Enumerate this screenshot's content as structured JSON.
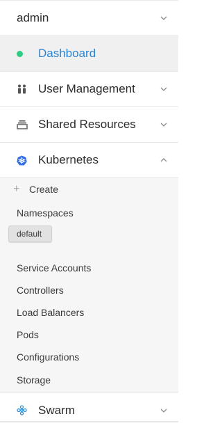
{
  "sidebar": {
    "account": {
      "label": "admin",
      "icon": "chevron-down-icon"
    },
    "items": [
      {
        "label": "Dashboard",
        "icon": "status-dot-icon",
        "active": true
      },
      {
        "label": "User Management",
        "icon": "users-icon",
        "expand_icon": "chevron-down-icon"
      },
      {
        "label": "Shared Resources",
        "icon": "stack-icon",
        "expand_icon": "chevron-down-icon"
      },
      {
        "label": "Kubernetes",
        "icon": "kubernetes-icon",
        "expand_icon": "chevron-up-icon",
        "expanded": true
      },
      {
        "label": "Swarm",
        "icon": "swarm-icon",
        "expand_icon": "chevron-down-icon"
      }
    ],
    "kubernetes": {
      "create_label": "Create",
      "namespaces_label": "Namespaces",
      "namespace_selected": "default",
      "links": [
        "Service Accounts",
        "Controllers",
        "Load Balancers",
        "Pods",
        "Configurations",
        "Storage"
      ]
    }
  },
  "colors": {
    "active_text": "#2a86d3",
    "active_dot": "#2ecb83",
    "kubernetes_blue": "#326ce5",
    "swarm_blue": "#1d8fd8"
  }
}
